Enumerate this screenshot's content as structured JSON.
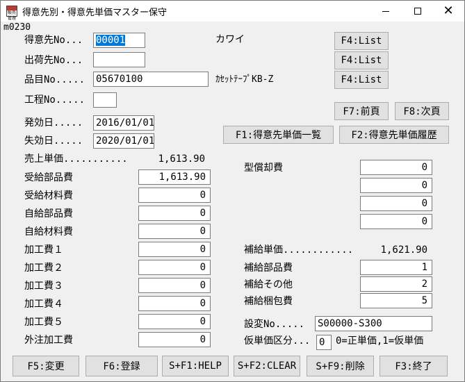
{
  "window": {
    "icon_text": "販売\n管理",
    "title": "得意先別・得意先単価マスター保守",
    "minimize": "—",
    "maximize": "□",
    "close": "✕"
  },
  "form_id": "m0230",
  "header": {
    "customer_no_label": "得意先No...",
    "customer_no_value": "00001",
    "customer_name": "カワイ",
    "shipto_no_label": "出荷先No...",
    "shipto_no_value": "",
    "item_no_label": "品目No.....",
    "item_no_value": "05670100",
    "item_name": "ｶｾｯﾄﾃｰﾌﾟKB-Z",
    "process_no_label": "工程No.....",
    "process_no_value": "",
    "effective_label": "発効日.....",
    "effective_value": "2016/01/01",
    "expiry_label": "失効日.....",
    "expiry_value": "2020/01/01"
  },
  "buttons": {
    "f4_list_1": "F4:List",
    "f4_list_2": "F4:List",
    "f4_list_3": "F4:List",
    "f7_prev": "F7:前頁",
    "f8_next": "F8:次頁",
    "f1_price_list": "F1:得意先単価一覧",
    "f2_price_history": "F2:得意先単価履歴"
  },
  "costs": {
    "sales_price_label": "売上単価...........",
    "sales_price_value": "1,613.90",
    "rows": [
      {
        "label": "受給部品費",
        "value": "1,613.90"
      },
      {
        "label": "受給材料費",
        "value": "0"
      },
      {
        "label": "自給部品費",
        "value": "0"
      },
      {
        "label": "自給材料費",
        "value": "0"
      },
      {
        "label": "加工費１",
        "value": "0"
      },
      {
        "label": "加工費２",
        "value": "0"
      },
      {
        "label": "加工費３",
        "value": "0"
      },
      {
        "label": "加工費４",
        "value": "0"
      },
      {
        "label": "加工費５",
        "value": "0"
      },
      {
        "label": "外注加工費",
        "value": "0"
      }
    ]
  },
  "right_panel": {
    "mold_amort_label": "型償却費",
    "mold_amort_values": [
      "0",
      "0",
      "0",
      "0"
    ],
    "supply_price_label": "補給単価............",
    "supply_price_value": "1,621.90",
    "supply_parts_label": "補給部品費",
    "supply_parts_value": "1",
    "supply_other_label": "補給その他",
    "supply_other_value": "2",
    "supply_pack_label": "補給梱包費",
    "supply_pack_value": "5",
    "design_change_label": "設変No.....",
    "design_change_value": "S00000-S300",
    "provisional_label": "仮単価区分...",
    "provisional_value": "0",
    "provisional_hint": "0=正単価,1=仮単価"
  },
  "footer": {
    "f5": "F5:変更",
    "f6": "F6:登録",
    "sf1": "S+F1:HELP",
    "sf2": "S+F2:CLEAR",
    "sf9": "S+F9:削除",
    "f3": "F3:終了"
  }
}
